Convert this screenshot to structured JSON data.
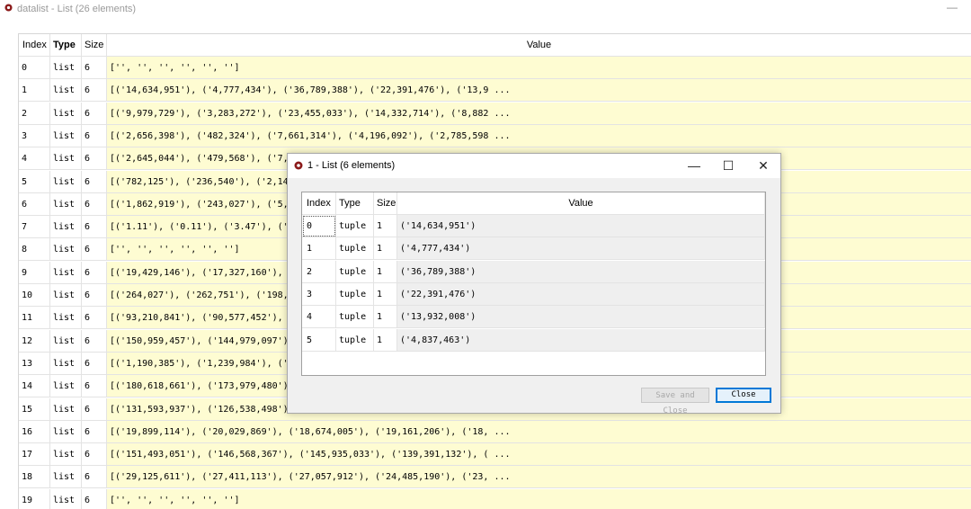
{
  "main_window": {
    "title": "datalist - List (26 elements)",
    "minimize_glyph": "—",
    "headers": {
      "index": "Index",
      "type": "Type",
      "size": "Size",
      "value": "Value"
    },
    "rows": [
      {
        "index": "0",
        "type": "list",
        "size": "6",
        "value": "['', '', '', '', '', '']"
      },
      {
        "index": "1",
        "type": "list",
        "size": "6",
        "value": "[('14,634,951'), ('4,777,434'), ('36,789,388'), ('22,391,476'), ('13,9 ..."
      },
      {
        "index": "2",
        "type": "list",
        "size": "6",
        "value": "[('9,979,729'), ('3,283,272'), ('23,455,033'), ('14,332,714'), ('8,882 ..."
      },
      {
        "index": "3",
        "type": "list",
        "size": "6",
        "value": "[('2,656,398'), ('482,324'), ('7,661,314'), ('4,196,092'), ('2,785,598 ..."
      },
      {
        "index": "4",
        "type": "list",
        "size": "6",
        "value": "[('2,645,044'), ('479,568'), ('7,"
      },
      {
        "index": "5",
        "type": "list",
        "size": "6",
        "value": "[('782,125'), ('236,540'), ('2,14"
      },
      {
        "index": "6",
        "type": "list",
        "size": "6",
        "value": "[('1,862,919'), ('243,027'), ('5,"
      },
      {
        "index": "7",
        "type": "list",
        "size": "6",
        "value": "[('1.11'), ('0.11'), ('3.47'), ('"
      },
      {
        "index": "8",
        "type": "list",
        "size": "6",
        "value": "['', '', '', '', '', '']"
      },
      {
        "index": "9",
        "type": "list",
        "size": "6",
        "value": "[('19,429,146'), ('17,327,160'),"
      },
      {
        "index": "10",
        "type": "list",
        "size": "6",
        "value": "[('264,027'), ('262,751'), ('198,"
      },
      {
        "index": "11",
        "type": "list",
        "size": "6",
        "value": "[('93,210,841'), ('90,577,452'),"
      },
      {
        "index": "12",
        "type": "list",
        "size": "6",
        "value": "[('150,959,457'), ('144,979,097')"
      },
      {
        "index": "13",
        "type": "list",
        "size": "6",
        "value": "[('1,190,385'), ('1,239,984'), ('"
      },
      {
        "index": "14",
        "type": "list",
        "size": "6",
        "value": "[('180,618,661'), ('173,979,480')"
      },
      {
        "index": "15",
        "type": "list",
        "size": "6",
        "value": "[('131,593,937'), ('126,538,498')"
      },
      {
        "index": "16",
        "type": "list",
        "size": "6",
        "value": "[('19,899,114'), ('20,029,869'), ('18,674,005'), ('19,161,206'), ('18, ..."
      },
      {
        "index": "17",
        "type": "list",
        "size": "6",
        "value": "[('151,493,051'), ('146,568,367'), ('145,935,033'), ('139,391,132'), ( ..."
      },
      {
        "index": "18",
        "type": "list",
        "size": "6",
        "value": "[('29,125,611'), ('27,411,113'), ('27,057,912'), ('24,485,190'), ('23, ..."
      },
      {
        "index": "19",
        "type": "list",
        "size": "6",
        "value": "['', '', '', '', '', '']"
      }
    ]
  },
  "dialog": {
    "title": "1 - List (6 elements)",
    "minimize_glyph": "—",
    "maximize_glyph": "☐",
    "close_glyph": "✕",
    "headers": {
      "index": "Index",
      "type": "Type",
      "size": "Size",
      "value": "Value"
    },
    "rows": [
      {
        "index": "0",
        "type": "tuple",
        "size": "1",
        "value": "('14,634,951')"
      },
      {
        "index": "1",
        "type": "tuple",
        "size": "1",
        "value": "('4,777,434')"
      },
      {
        "index": "2",
        "type": "tuple",
        "size": "1",
        "value": "('36,789,388')"
      },
      {
        "index": "3",
        "type": "tuple",
        "size": "1",
        "value": "('22,391,476')"
      },
      {
        "index": "4",
        "type": "tuple",
        "size": "1",
        "value": "('13,932,008')"
      },
      {
        "index": "5",
        "type": "tuple",
        "size": "1",
        "value": "('4,837,463')"
      }
    ],
    "save_close_label": "Save and Close",
    "close_label": "Close"
  },
  "colors": {
    "value_bg": "#fefcd2",
    "dialog_value_bg": "#efefef",
    "accent": "#0078d7"
  },
  "icons": {
    "app": "spyder-app-icon"
  }
}
